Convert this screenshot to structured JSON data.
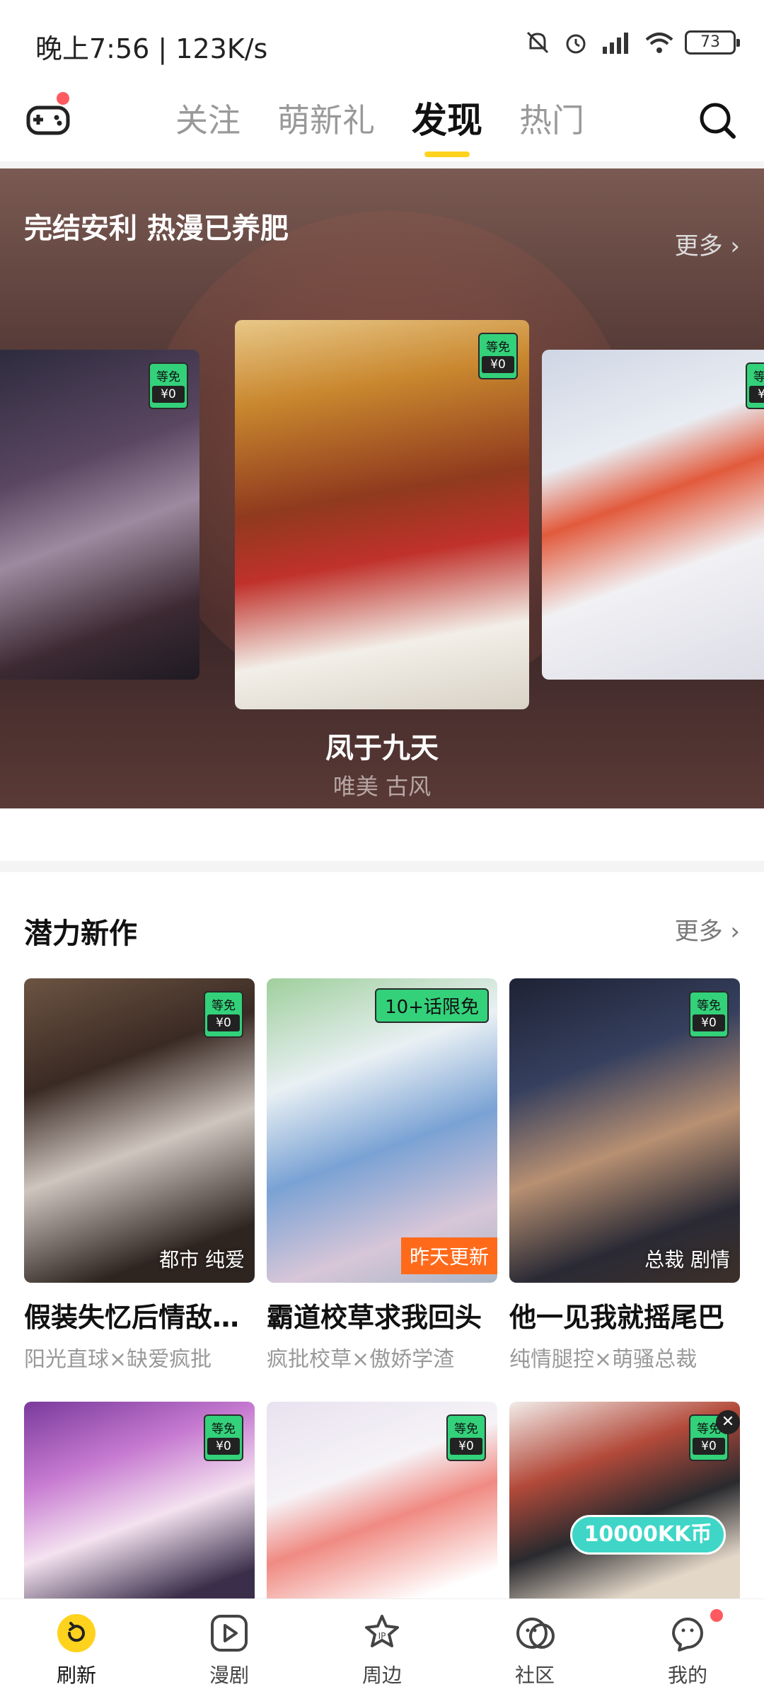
{
  "status_bar": {
    "time": "晚上7:56 | 123K/s",
    "battery": "73"
  },
  "top_nav": {
    "tabs": [
      {
        "label": "关注"
      },
      {
        "label": "萌新礼"
      },
      {
        "label": "发现"
      },
      {
        "label": "热门"
      }
    ],
    "active_tab": "发现"
  },
  "banner": {
    "title": "完结安利 热漫已养肥",
    "more": "更多 ›",
    "featured": {
      "name": "凤于九天",
      "tags": "唯美 古风"
    },
    "badge_top": "等免",
    "badge_bottom": "¥0"
  },
  "section": {
    "title": "潜力新作",
    "more": "更多 ›",
    "cards": [
      {
        "title": "假装失忆后情敌…",
        "subtitle": "阳光直球×缺爱疯批",
        "tag": "都市 纯爱"
      },
      {
        "title": "霸道校草求我回头",
        "subtitle": "疯批校草×傲娇学渣",
        "ribbon": "10+话限免",
        "update": "昨天更新"
      },
      {
        "title": "他一见我就摇尾巴",
        "subtitle": "纯情腿控×萌骚总裁",
        "tag": "总裁 剧情"
      }
    ],
    "second_row_promo": "10000KK币"
  },
  "bottom_nav": {
    "items": [
      {
        "label": "刷新"
      },
      {
        "label": "漫剧"
      },
      {
        "label": "周边"
      },
      {
        "label": "社区"
      },
      {
        "label": "我的"
      }
    ]
  },
  "colors": {
    "accent": "#ffd21e",
    "free_green": "#33d17a",
    "update_orange": "#ff6a1a",
    "badge_red": "#ff5a5f"
  }
}
